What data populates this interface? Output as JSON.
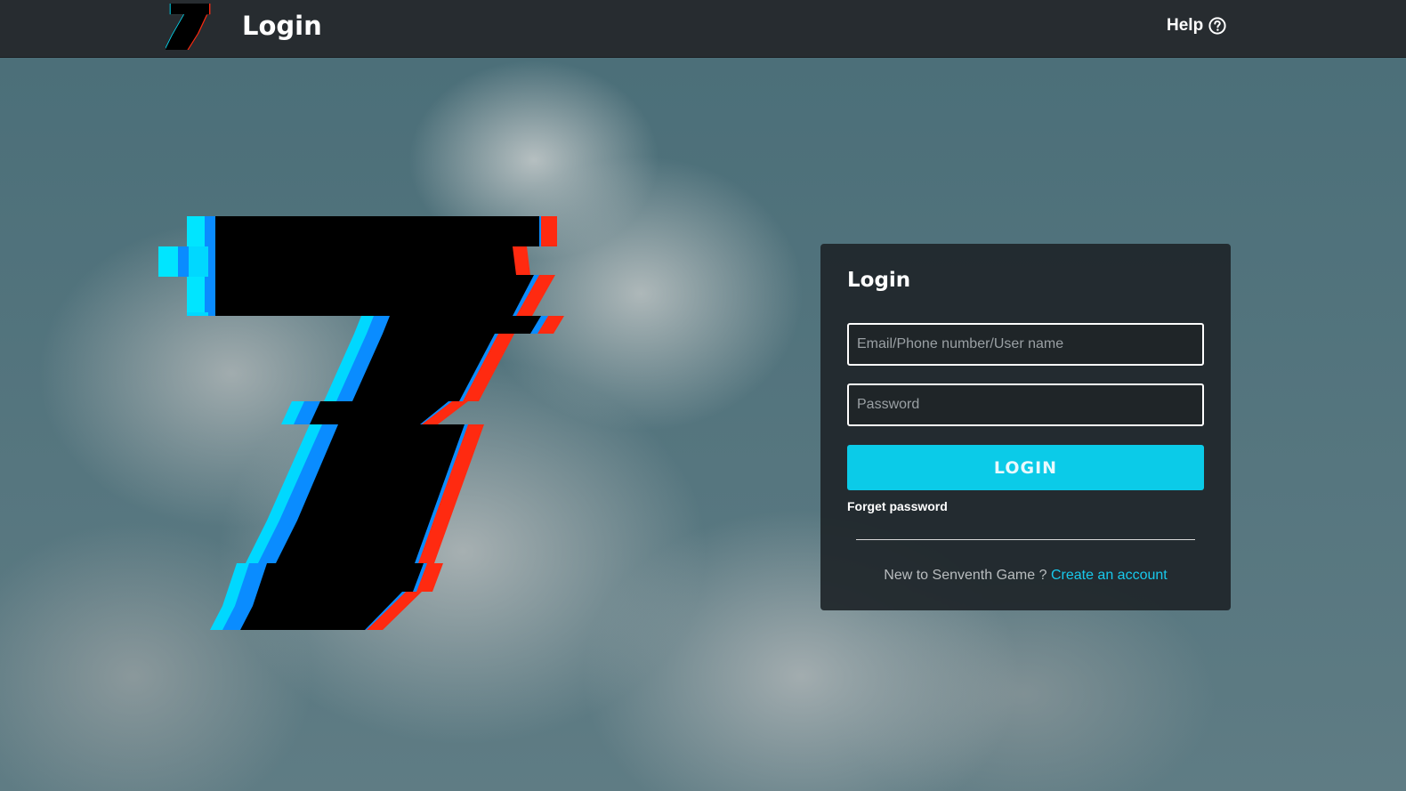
{
  "header": {
    "title": "Login",
    "help_label": "Help",
    "logo_icon": "seven-logo-icon",
    "help_icon": "question-circle-icon"
  },
  "login_card": {
    "title": "Login",
    "identity_placeholder": "Email/Phone number/User name",
    "identity_value": "",
    "password_placeholder": "Password",
    "password_value": "",
    "login_button": "LOGIN",
    "forget_password": "Forget password",
    "signup_prompt": "New to Senventh Game ?",
    "signup_link": "Create an account"
  },
  "colors": {
    "topbar": "#272c30",
    "accent_cyan": "#0bcbe8",
    "logo_blue": "#0aa0ff",
    "logo_red": "#ff2a10",
    "card_bg": "#1f262a"
  }
}
